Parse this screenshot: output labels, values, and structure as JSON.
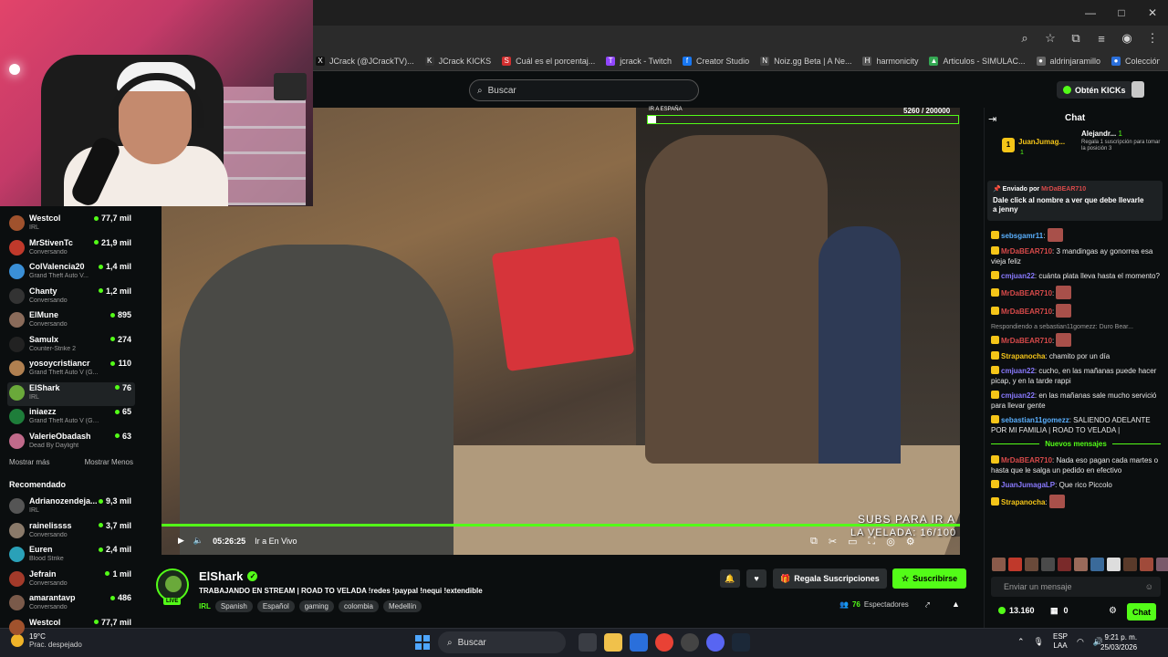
{
  "browser": {
    "window_controls": [
      "—",
      "□",
      "✕"
    ],
    "bookmarks": [
      {
        "icon": "x-icon",
        "label": "JCrack (@JCrackTV)...",
        "color": "#111111",
        "glyph": "X"
      },
      {
        "icon": "kick-icon",
        "label": "JCrack KICKS",
        "color": "#333333",
        "glyph": "K"
      },
      {
        "icon": "s-icon",
        "label": "Cuál es el porcentaj...",
        "color": "#d32f2f",
        "glyph": "S"
      },
      {
        "icon": "twitch-icon",
        "label": "jcrack - Twitch",
        "color": "#9146ff",
        "glyph": "T"
      },
      {
        "icon": "facebook-icon",
        "label": "Creator Studio",
        "color": "#1877f2",
        "glyph": "f"
      },
      {
        "icon": "noiz-icon",
        "label": "Noiz.gg Beta | A Ne...",
        "color": "#444444",
        "glyph": "N"
      },
      {
        "icon": "harmonicity-icon",
        "label": "harmonicity",
        "color": "#555555",
        "glyph": "H"
      },
      {
        "icon": "drive-icon",
        "label": "Articulos - SIMULAC...",
        "color": "#34a853",
        "glyph": "▲"
      },
      {
        "icon": "globe-icon",
        "label": "aldrinjaramillo",
        "color": "#666666",
        "glyph": "●"
      },
      {
        "icon": "globe-icon",
        "label": "Colección de M_bleí...",
        "color": "#2a6fdb",
        "glyph": "●"
      }
    ]
  },
  "topnav": {
    "search_placeholder": "Buscar",
    "get_kicks": "Obtén KICKs"
  },
  "sidebar": {
    "following": [
      {
        "name": "Westcol",
        "game": "IRL",
        "viewers": "77,7 mil",
        "color": "#a0522d"
      },
      {
        "name": "MrStivenTc",
        "game": "Conversando",
        "viewers": "21,9 mil",
        "color": "#c0392b"
      },
      {
        "name": "ColValencia20",
        "game": "Grand Theft Auto V...",
        "viewers": "1,4 mil",
        "color": "#3a8fd6"
      },
      {
        "name": "Chanty",
        "game": "Conversando",
        "viewers": "1,2 mil",
        "color": "#333333"
      },
      {
        "name": "ElMune",
        "game": "Conversando",
        "viewers": "895",
        "color": "#8a6b5a"
      },
      {
        "name": "Samulx",
        "game": "Counter-Strike 2",
        "viewers": "274",
        "color": "#222222"
      },
      {
        "name": "yosoycristiancr",
        "game": "Grand Theft Auto V (G...",
        "viewers": "110",
        "color": "#b08050"
      },
      {
        "name": "ElShark",
        "game": "IRL",
        "viewers": "76",
        "color": "#6aa93a"
      },
      {
        "name": "iniaezz",
        "game": "Grand Theft Auto V (GTA)",
        "viewers": "65",
        "color": "#1e7d3a"
      },
      {
        "name": "ValerieObadash",
        "game": "Dead By Daylight",
        "viewers": "63",
        "color": "#c06a8a"
      }
    ],
    "show_more": "Mostrar más",
    "show_less": "Mostrar Menos",
    "recommended_title": "Recomendado",
    "recommended": [
      {
        "name": "Adrianozendeja...",
        "game": "IRL",
        "viewers": "9,3 mil",
        "color": "#555555"
      },
      {
        "name": "rainelissss",
        "game": "Conversando",
        "viewers": "3,7 mil",
        "color": "#8a7a6a"
      },
      {
        "name": "Euren",
        "game": "Blood Strike",
        "viewers": "2,4 mil",
        "color": "#2aa1b8"
      },
      {
        "name": "Jefrain",
        "game": "Conversando",
        "viewers": "1 mil",
        "color": "#a33a2a"
      },
      {
        "name": "amarantavp",
        "game": "Conversando",
        "viewers": "486",
        "color": "#7a5a4a"
      },
      {
        "name": "Westcol",
        "game": "",
        "viewers": "77,7 mil",
        "color": "#a0522d"
      }
    ]
  },
  "video": {
    "overlay_label": "IR A ESPAÑA",
    "overlay_count": "5260 / 200000",
    "subs_line1": "SUBS PARA IR A",
    "subs_line2": "LA VELADA: 16/100",
    "time": "05:26:25",
    "go_live": "Ir a En Vivo",
    "progress_goal": 0.026
  },
  "streamer": {
    "name": "ElShark",
    "live": "LIVE",
    "title": "TRABAJANDO EN STREAM | ROAD TO VELADA !redes !paypal !nequi !extendible",
    "category": "IRL",
    "tags": [
      "Spanish",
      "Español",
      "gaming",
      "colombia",
      "Medellín"
    ],
    "gift_subs": "Regala Suscripciones",
    "subscribe": "Suscribirse",
    "viewers": "76",
    "viewers_label": "Espectadores"
  },
  "chat": {
    "title": "Chat",
    "top_gifter1_rank": "1",
    "top_gifter1_name": "JuanJumag...",
    "top_gifter1_count": "1",
    "top_gifter2_name": "Alejandr...",
    "top_gifter2_count": "1",
    "top_gifter2_desc": "Regala 1 suscripción para tomar la posición 3",
    "pinned_prefix": "Enviado por",
    "pinned_user": "MrDaBEAR710",
    "pinned_message": "Dale click al nombre a ver que debe llevarle a jenny",
    "messages": [
      {
        "user": "sebsgamr11",
        "color": "#5ab0ff",
        "text": "",
        "emote": true
      },
      {
        "user": "MrDaBEAR710",
        "color": "#d84a4a",
        "text": "3 mandingas ay gonorrea esa vieja feliz"
      },
      {
        "user": "cmjuan22",
        "color": "#8a7aff",
        "text": "cuánta plata lleva hasta el momento?"
      },
      {
        "user": "MrDaBEAR710",
        "color": "#d84a4a",
        "text": "",
        "emote": true
      },
      {
        "user": "MrDaBEAR710",
        "color": "#d84a4a",
        "text": "",
        "emote": true
      },
      {
        "reply": "Respondiendo a sebastian11gomezz: Duro Bear...",
        "user": "MrDaBEAR710",
        "color": "#d84a4a",
        "text": "",
        "emote": true
      },
      {
        "user": "Strapanocha",
        "color": "#f5c518",
        "text": "chamito por un día"
      },
      {
        "user": "cmjuan22",
        "color": "#8a7aff",
        "text": "cucho, en las mañanas puede hacer picap, y en la tarde rappi"
      },
      {
        "user": "cmjuan22",
        "color": "#8a7aff",
        "text": "en las mañanas sale mucho servició para llevar gente"
      },
      {
        "user": "sebastian11gomezz",
        "color": "#5ab0ff",
        "text": "SALIENDO ADELANTE POR MI FAMILIA | ROAD TO VELADA |"
      }
    ],
    "new_messages": "Nuevos mensajes",
    "messages_after": [
      {
        "user": "MrDaBEAR710",
        "color": "#d84a4a",
        "text": "Nada eso pagan cada martes o hasta que le salga un pedido en efectivo"
      },
      {
        "user": "JuanJumagaLP",
        "color": "#8a7aff",
        "text": "Que rico Piccolo"
      },
      {
        "user": "Strapanocha",
        "color": "#f5c518",
        "text": "",
        "emote": true
      }
    ],
    "input_placeholder": "Enviar un mensaje",
    "kicks_balance": "13.160",
    "points_balance": "0",
    "send": "Chat"
  },
  "taskbar": {
    "temp": "19°C",
    "weather": "Prac. despejado",
    "search": "Buscar",
    "lang1": "ESP",
    "lang2": "LAA",
    "time": "9:21 p. m.",
    "date": "25/03/2026"
  },
  "colors": {
    "kick_green": "#53fc18"
  }
}
